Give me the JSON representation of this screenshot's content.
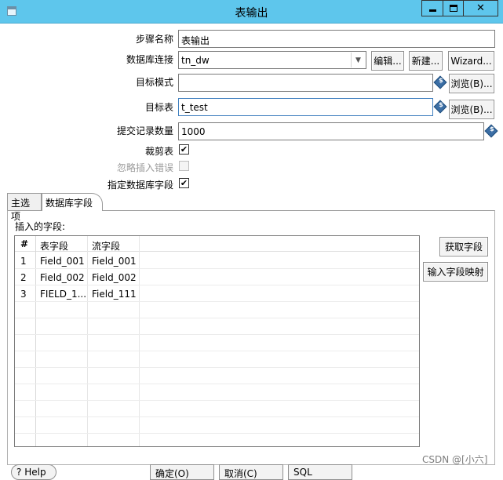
{
  "window": {
    "title": "表输出",
    "minimize_icon": "minimize-icon",
    "maximize_icon": "maximize-icon",
    "close_icon": "close-icon"
  },
  "form": {
    "step_name": {
      "label": "步骤名称",
      "value": "表输出"
    },
    "connection": {
      "label": "数据库连接",
      "value": "tn_dw",
      "edit": "编辑...",
      "new": "新建...",
      "wizard": "Wizard..."
    },
    "target_schema": {
      "label": "目标模式",
      "value": "",
      "browse": "浏览(B)..."
    },
    "target_table": {
      "label": "目标表",
      "value": "t_test",
      "browse": "浏览(B)..."
    },
    "commit_size": {
      "label": "提交记录数量",
      "value": "1000"
    },
    "truncate_table": {
      "label": "裁剪表",
      "checked": true,
      "mark": "✔"
    },
    "ignore_insert_errors": {
      "label": "忽略插入错误",
      "checked": false,
      "disabled": true
    },
    "specify_db_fields": {
      "label": "指定数据库字段",
      "checked": true,
      "mark": "✔"
    }
  },
  "tabs": [
    {
      "label": "主选项",
      "selected": false
    },
    {
      "label": "数据库字段",
      "selected": true
    }
  ],
  "fields_panel": {
    "heading": "插入的字段:",
    "columns": [
      "#",
      "表字段",
      "流字段"
    ],
    "rows": [
      {
        "num": "1",
        "table_field": "Field_001",
        "stream_field": "Field_001"
      },
      {
        "num": "2",
        "table_field": "Field_002",
        "stream_field": "Field_002"
      },
      {
        "num": "3",
        "table_field": "FIELD_1...",
        "stream_field": "Field_111"
      }
    ],
    "get_fields": "获取字段",
    "input_mapping": "输入字段映射"
  },
  "footer": {
    "help": "Help",
    "ok": "确定(O)",
    "cancel": "取消(C)",
    "sql": "SQL"
  },
  "watermark": "CSDN @[小六]",
  "colors": {
    "titlebar": "#5ec6ec",
    "variable_icon": "#3b6ea5"
  }
}
